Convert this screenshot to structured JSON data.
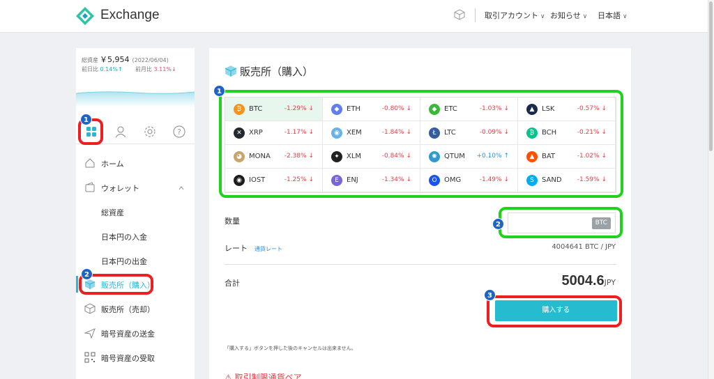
{
  "header": {
    "brand": "Exchange",
    "menu": [
      {
        "label": "取引アカウント"
      },
      {
        "label": "お知らせ"
      },
      {
        "label": "日本語"
      }
    ],
    "chevron": "∨"
  },
  "sidebar": {
    "balance_label": "総資産",
    "balance_value": "￥5,954",
    "balance_date": "(2022/06/04)",
    "day_change_label": "前日比",
    "day_change_value": "0.14%↑",
    "month_change_label": "前月比",
    "month_change_value": "3.11%↓",
    "tabs": [
      "dashboard-icon",
      "user-icon",
      "gear-icon",
      "help-icon"
    ],
    "items": [
      {
        "label": "ホーム",
        "icon": "home-icon"
      },
      {
        "label": "ウォレット",
        "icon": "wallet-icon"
      },
      {
        "label": "総資産"
      },
      {
        "label": "日本円の入金"
      },
      {
        "label": "日本円の出金"
      },
      {
        "label": "販売所（購入）",
        "icon": "cube-icon",
        "active": true
      },
      {
        "label": "販売所（売却）",
        "icon": "cube-icon"
      },
      {
        "label": "暗号資産の送金",
        "icon": "send-icon"
      },
      {
        "label": "暗号資産の受取",
        "icon": "qr-icon"
      }
    ]
  },
  "main": {
    "title": "販売所（購入）",
    "coins": [
      {
        "sym": "BTC",
        "chg": "-1.29%",
        "dir": "down",
        "color": "#f7931a",
        "glyph": "₿"
      },
      {
        "sym": "ETH",
        "chg": "-0.80%",
        "dir": "down",
        "color": "#627eea",
        "glyph": "◆"
      },
      {
        "sym": "ETC",
        "chg": "-1.03%",
        "dir": "down",
        "color": "#3ab83a",
        "glyph": "◆"
      },
      {
        "sym": "LSK",
        "chg": "-0.57%",
        "dir": "down",
        "color": "#1a2b4a",
        "glyph": "▲"
      },
      {
        "sym": "XRP",
        "chg": "-1.17%",
        "dir": "down",
        "color": "#23292f",
        "glyph": "✕"
      },
      {
        "sym": "XEM",
        "chg": "-1.84%",
        "dir": "down",
        "color": "#67b2e8",
        "glyph": "◉"
      },
      {
        "sym": "LTC",
        "chg": "-0.09%",
        "dir": "down",
        "color": "#345d9d",
        "glyph": "Ł"
      },
      {
        "sym": "BCH",
        "chg": "-0.21%",
        "dir": "down",
        "color": "#0ac18e",
        "glyph": "₿"
      },
      {
        "sym": "MONA",
        "chg": "-2.38%",
        "dir": "down",
        "color": "#c9a56b",
        "glyph": "◕"
      },
      {
        "sym": "XLM",
        "chg": "-0.84%",
        "dir": "down",
        "color": "#222222",
        "glyph": "✦"
      },
      {
        "sym": "QTUM",
        "chg": "+0.10%",
        "dir": "up",
        "color": "#2e9ad0",
        "glyph": "✺"
      },
      {
        "sym": "BAT",
        "chg": "-1.02%",
        "dir": "down",
        "color": "#ff5000",
        "glyph": "▲"
      },
      {
        "sym": "IOST",
        "chg": "-1.25%",
        "dir": "down",
        "color": "#1c1c1c",
        "glyph": "◉"
      },
      {
        "sym": "ENJ",
        "chg": "-1.34%",
        "dir": "down",
        "color": "#7866d5",
        "glyph": "E"
      },
      {
        "sym": "OMG",
        "chg": "-1.49%",
        "dir": "down",
        "color": "#1a53f0",
        "glyph": "O"
      },
      {
        "sym": "SAND",
        "chg": "-1.59%",
        "dir": "down",
        "color": "#00adef",
        "glyph": "S"
      }
    ],
    "qty_label": "数量",
    "qty_unit": "BTC",
    "rate_label": "レート",
    "rate_link": "通貨レート",
    "rate_value": "4004641  BTC / JPY",
    "total_label": "合計",
    "total_value": "5004.6",
    "total_unit": "JPY",
    "buy_label": "購入する",
    "note": "「購入する」ボタンを押した後のキャンセルは出来ません。",
    "warning": "⚠ 取引制限通貨ペア"
  },
  "annotations": {
    "badges": [
      "1",
      "2",
      "1",
      "2",
      "3"
    ],
    "green": "#1ed21e",
    "red": "#ec2020",
    "badge_color": "#1e64c8"
  }
}
